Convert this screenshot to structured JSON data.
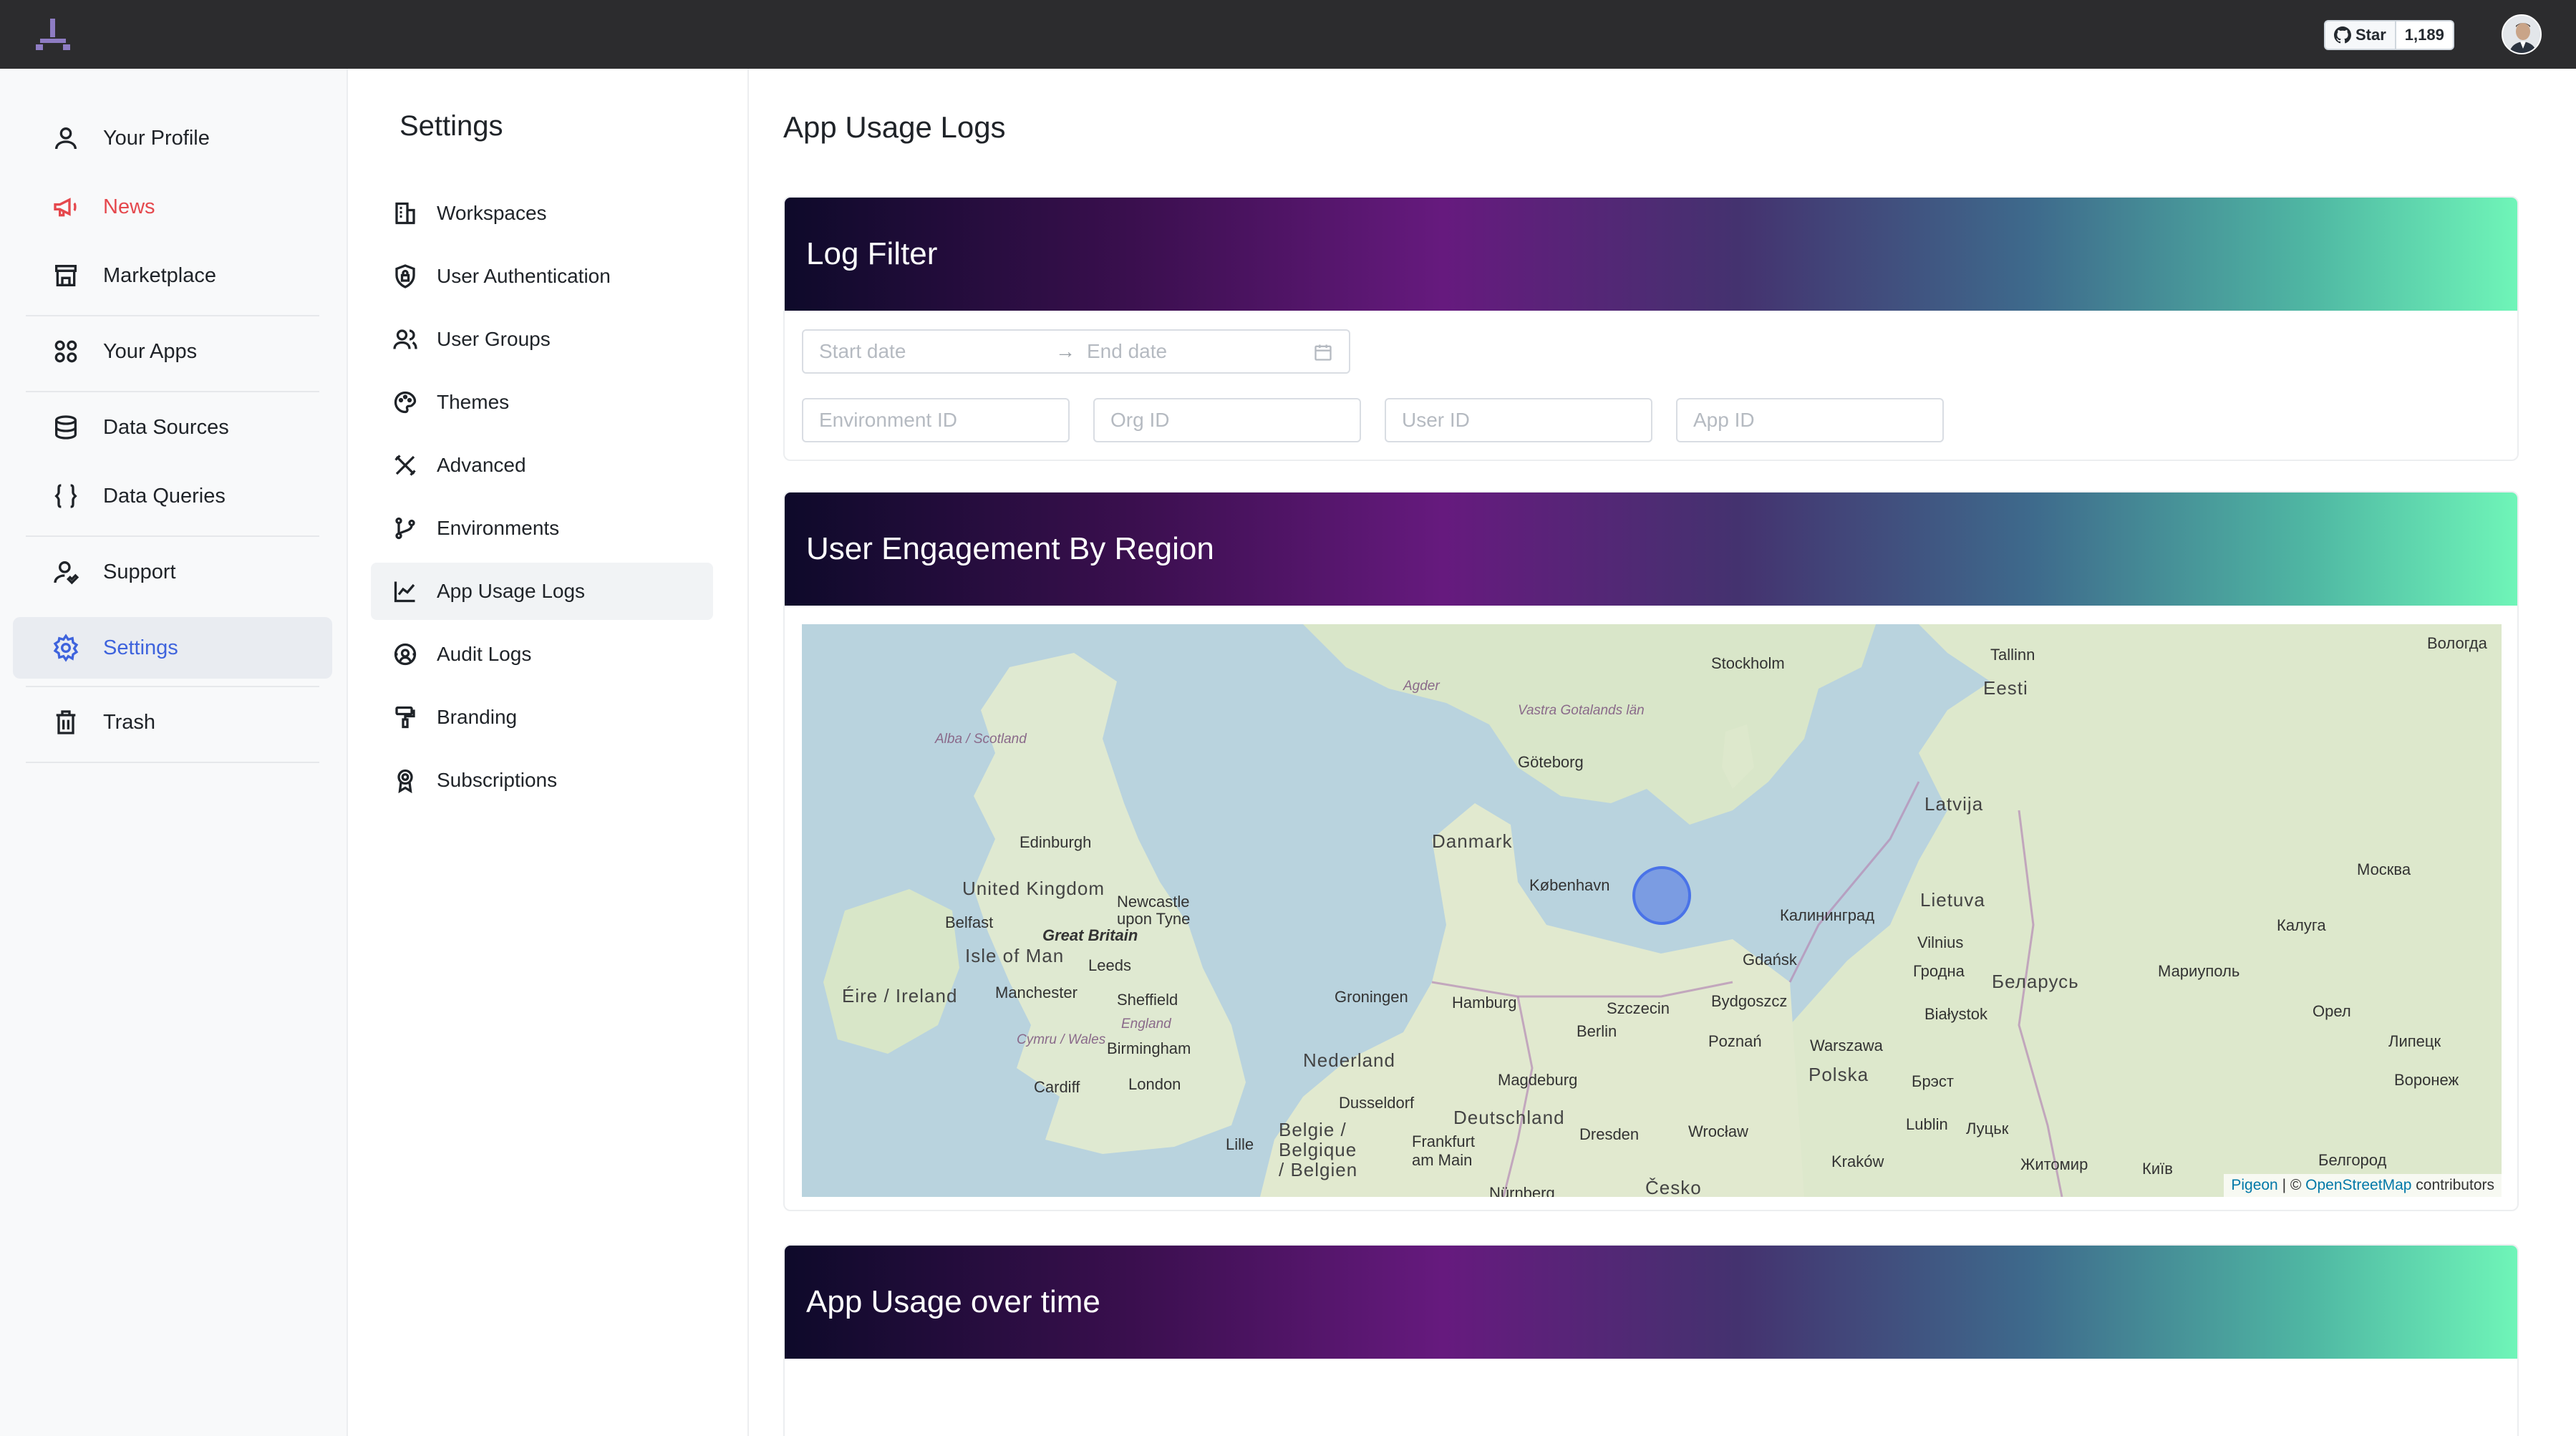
{
  "topbar": {
    "github_star_label": "Star",
    "github_star_count": "1,189"
  },
  "sidebar": {
    "items": [
      {
        "label": "Your Profile",
        "icon": "user-icon"
      },
      {
        "label": "News",
        "icon": "megaphone-icon"
      },
      {
        "label": "Marketplace",
        "icon": "store-icon"
      },
      {
        "label": "Your Apps",
        "icon": "apps-grid-icon"
      },
      {
        "label": "Data Sources",
        "icon": "database-icon"
      },
      {
        "label": "Data Queries",
        "icon": "braces-icon"
      },
      {
        "label": "Support",
        "icon": "user-support-icon"
      },
      {
        "label": "Settings",
        "icon": "gear-icon"
      },
      {
        "label": "Trash",
        "icon": "trash-icon"
      }
    ],
    "active": "Settings",
    "highlight_color": "#e5484d"
  },
  "settings_nav": {
    "title": "Settings",
    "items": [
      {
        "label": "Workspaces",
        "icon": "building-icon"
      },
      {
        "label": "User Authentication",
        "icon": "shield-lock-icon"
      },
      {
        "label": "User Groups",
        "icon": "users-icon"
      },
      {
        "label": "Themes",
        "icon": "palette-icon"
      },
      {
        "label": "Advanced",
        "icon": "tools-icon"
      },
      {
        "label": "Environments",
        "icon": "git-branch-icon"
      },
      {
        "label": "App Usage Logs",
        "icon": "chart-line-icon"
      },
      {
        "label": "Audit Logs",
        "icon": "audit-icon"
      },
      {
        "label": "Branding",
        "icon": "paint-roller-icon"
      },
      {
        "label": "Subscriptions",
        "icon": "badge-icon"
      }
    ],
    "active": "App Usage Logs"
  },
  "main": {
    "title": "App Usage Logs",
    "log_filter": {
      "title": "Log Filter",
      "start_date_placeholder": "Start date",
      "arrow": "→",
      "end_date_placeholder": "End date",
      "environment_id_placeholder": "Environment ID",
      "org_id_placeholder": "Org ID",
      "user_id_placeholder": "User ID",
      "app_id_placeholder": "App ID"
    },
    "engagement": {
      "title": "User Engagement By Region",
      "map_labels": [
        "Stockholm",
        "Tallinn",
        "Eesti",
        "Вологда",
        "Agder",
        "Vastra Gotalands län",
        "Göteborg",
        "Alba / Scotland",
        "Latvija",
        "Edinburgh",
        "Danmark",
        "København",
        "United Kingdom",
        "Newcastle upon Tyne",
        "Belfast",
        "Great Britain",
        "Isle of Man",
        "Leeds",
        "Lietuva",
        "Калининград",
        "Vilnius",
        "Москва",
        "Калуга",
        "Éire / Ireland",
        "Manchester",
        "Sheffield",
        "Groningen",
        "Hamburg",
        "Gdańsk",
        "Гродна",
        "Беларусь",
        "Мариуполь",
        "England",
        "Birmingham",
        "Cymru / Wales",
        "Szczecin",
        "Bydgoszcz",
        "Białystok",
        "Орел",
        "Cardiff",
        "London",
        "Nederland",
        "Berlin",
        "Poznań",
        "Warszawa",
        "Polska",
        "Брэст",
        "Липецк",
        "Воронеж",
        "Dusseldorf",
        "Magdeburg",
        "Deutschland",
        "Lublin",
        "Луцьк",
        "Belgie / Belgique / Belgien",
        "Lille",
        "Frankfurt am Main",
        "Dresden",
        "Wrocław",
        "Kraków",
        "Житомир",
        "Київ",
        "Белгород",
        "Česko",
        "Nürnberg"
      ],
      "attribution_pigeon": "Pigeon",
      "attribution_sep": " | © ",
      "attribution_osm": "OpenStreetMap",
      "attribution_suffix": " contributors",
      "marker_region": "Baltic Sea"
    },
    "usage_over_time": {
      "title": "App Usage over time"
    }
  }
}
